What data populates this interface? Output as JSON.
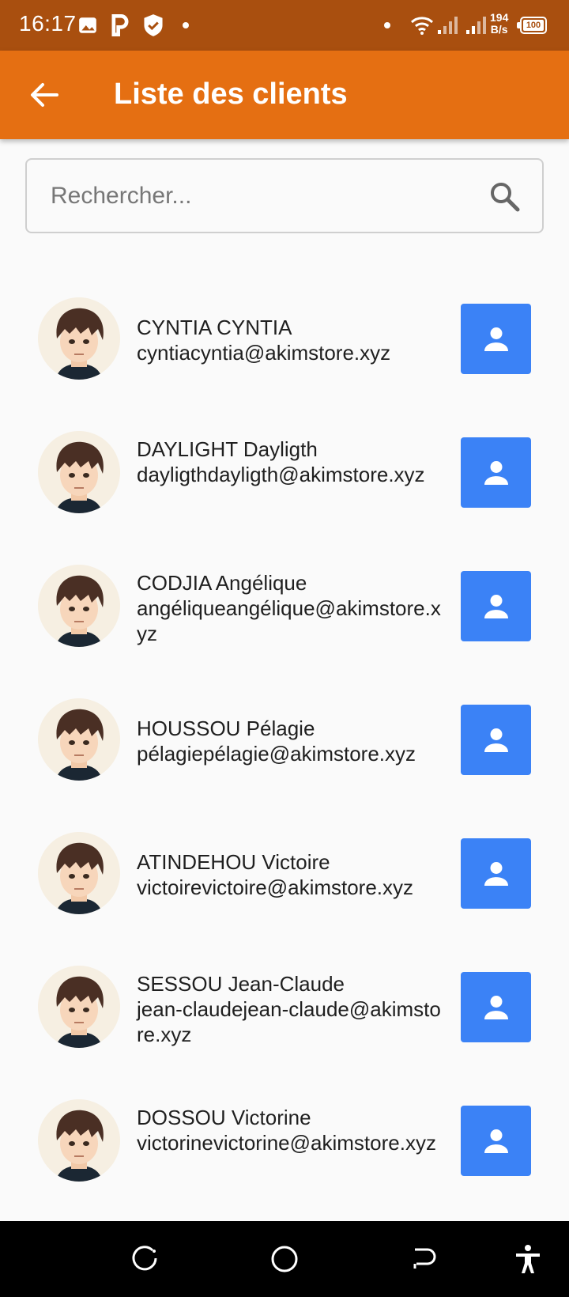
{
  "status_bar": {
    "time": "16:17",
    "icons": [
      "image-icon",
      "parking-app-icon",
      "shield-check-icon",
      "wifi-icon",
      "signal-icon",
      "signal-icon"
    ],
    "net_speed_value": "194",
    "net_speed_unit": "B/s",
    "battery": "100"
  },
  "app_bar": {
    "title": "Liste des clients",
    "back_icon": "arrow-back-icon",
    "color": "#e56f12"
  },
  "search": {
    "placeholder": "Rechercher...",
    "value": "",
    "icon": "search-icon"
  },
  "clients": [
    {
      "name": "CYNTIA CYNTIA",
      "email": "cyntiacyntia@akimstore.xyz"
    },
    {
      "name": "DAYLIGHT Dayligth",
      "email": "dayligthdayligth@akimstore.xyz"
    },
    {
      "name": "CODJIA Angélique",
      "email": "angéliqueangélique@akimstore.xyz"
    },
    {
      "name": "HOUSSOU Pélagie",
      "email": "pélagiepélagie@akimstore.xyz"
    },
    {
      "name": "ATINDEHOU Victoire",
      "email": "victoirevictoire@akimstore.xyz"
    },
    {
      "name": "SESSOU Jean-Claude",
      "email": "jean-claudejean-claude@akimstore.xyz"
    },
    {
      "name": "DOSSOU Victorine",
      "email": "victorinevictorine@akimstore.xyz"
    }
  ],
  "client_action_icon": "person-icon",
  "client_action_color": "#3b82f6",
  "nav_bar": {
    "icons": [
      "recent-apps-icon",
      "home-icon",
      "back-icon",
      "accessibility-icon"
    ]
  }
}
